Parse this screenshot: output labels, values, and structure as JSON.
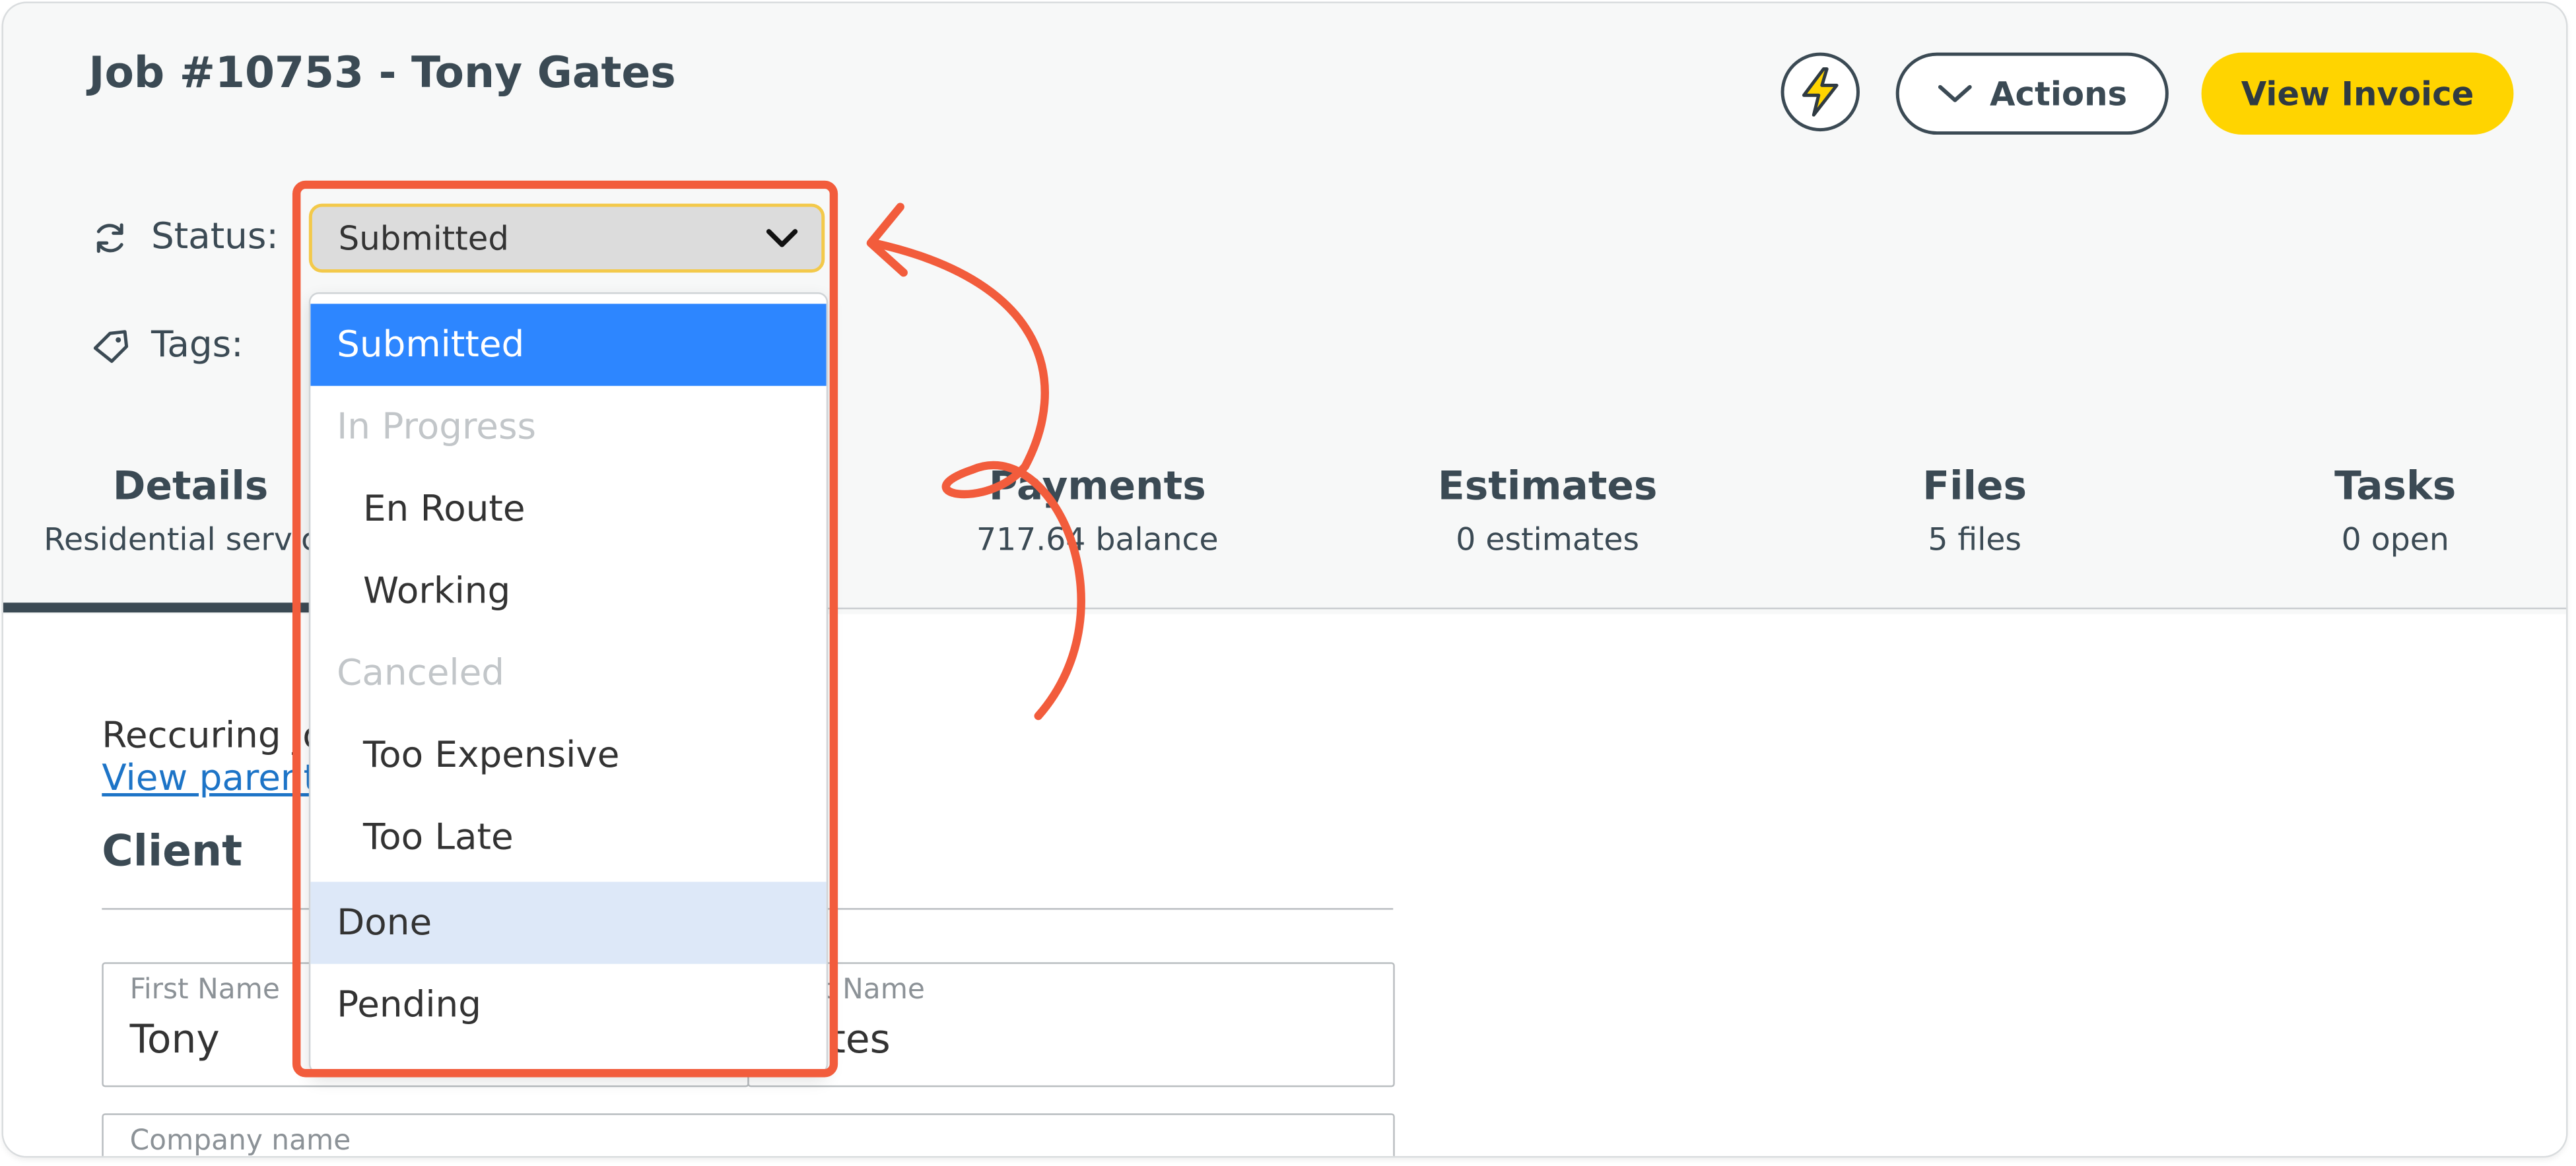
{
  "header": {
    "title": "Job #10753 - Tony Gates",
    "actions_label": "Actions",
    "view_invoice_label": "View Invoice"
  },
  "status": {
    "label": "Status:",
    "selected": "Submitted",
    "options": [
      {
        "label": "Submitted",
        "state": "selected"
      },
      {
        "label": "In Progress",
        "state": "group"
      },
      {
        "label": "En Route",
        "state": "child"
      },
      {
        "label": "Working",
        "state": "child"
      },
      {
        "label": "Canceled",
        "state": "group"
      },
      {
        "label": "Too Expensive",
        "state": "child"
      },
      {
        "label": "Too Late",
        "state": "child"
      },
      {
        "label": "Done",
        "state": "hover"
      },
      {
        "label": "Pending",
        "state": "normal"
      }
    ]
  },
  "tags": {
    "label": "Tags:"
  },
  "tabs": [
    {
      "title": "Details",
      "subtitle": "Residential service"
    },
    {
      "title": "Payments",
      "subtitle": "717.64 balance"
    },
    {
      "title": "Estimates",
      "subtitle": "0 estimates"
    },
    {
      "title": "Files",
      "subtitle": "5 files"
    },
    {
      "title": "Tasks",
      "subtitle": "0 open"
    }
  ],
  "details": {
    "recurring_text": "Reccuring job",
    "view_parent_link": "View parent job",
    "client_heading": "Client",
    "first_name_label": "First Name",
    "first_name_value": "Tony",
    "last_name_label": "Last Name",
    "last_name_value": "Gates",
    "company_label": "Company name"
  },
  "colors": {
    "accent_yellow": "#ffd400",
    "selected_blue": "#2d86ff",
    "annotation_red": "#f25c3c",
    "text_dark": "#3b4a54"
  },
  "icons": [
    "sync-icon",
    "tag-icon",
    "bolt-icon",
    "chevron-down-icon"
  ]
}
